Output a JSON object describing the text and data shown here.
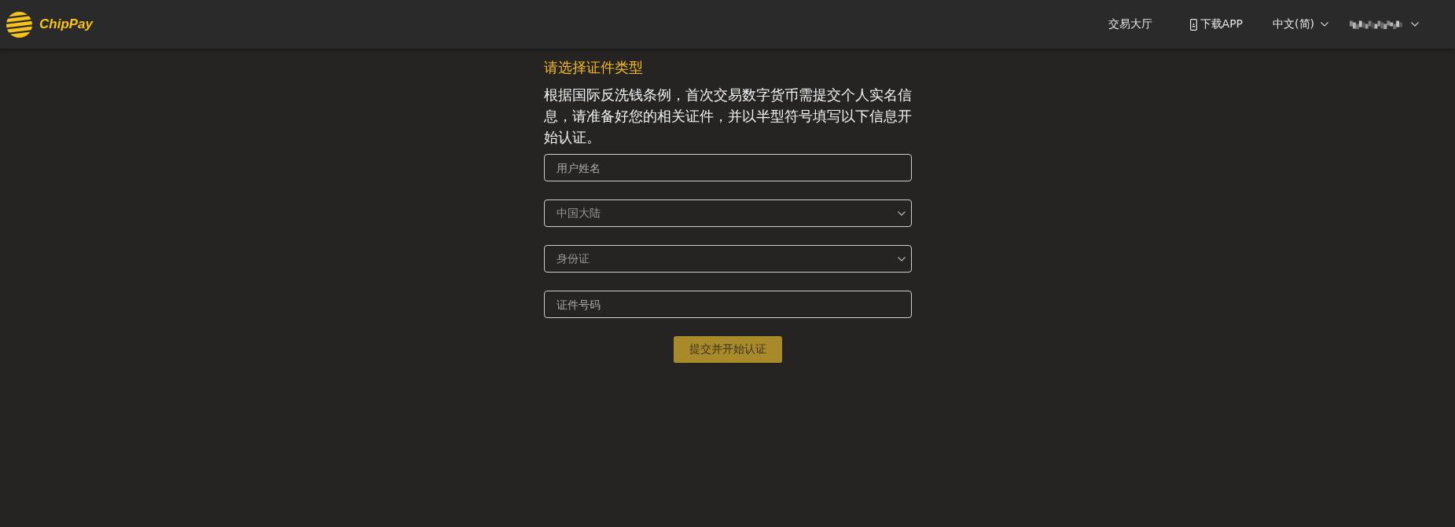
{
  "header": {
    "logo": {
      "text": "ChipPay"
    },
    "nav": [
      {
        "kind": "link",
        "label": "交易大厅"
      },
      {
        "kind": "download",
        "label": "下载APP"
      },
      {
        "kind": "dropdown",
        "label": "中文(简)"
      },
      {
        "kind": "account"
      }
    ]
  },
  "form": {
    "title": "请选择证件类型",
    "notice": "根据国际反洗钱条例，首次交易数字货币需提交个人实名信息，请准备好您的相关证件，并以半型符号填写以下信息开始认证。",
    "fields": [
      {
        "kind": "input",
        "placeholder": "用户姓名"
      },
      {
        "kind": "select",
        "value": "中国大陆"
      },
      {
        "kind": "select",
        "value": "身份证"
      },
      {
        "kind": "input",
        "placeholder": "证件号码"
      }
    ],
    "submit": {
      "label": "提交并开始认证"
    }
  }
}
